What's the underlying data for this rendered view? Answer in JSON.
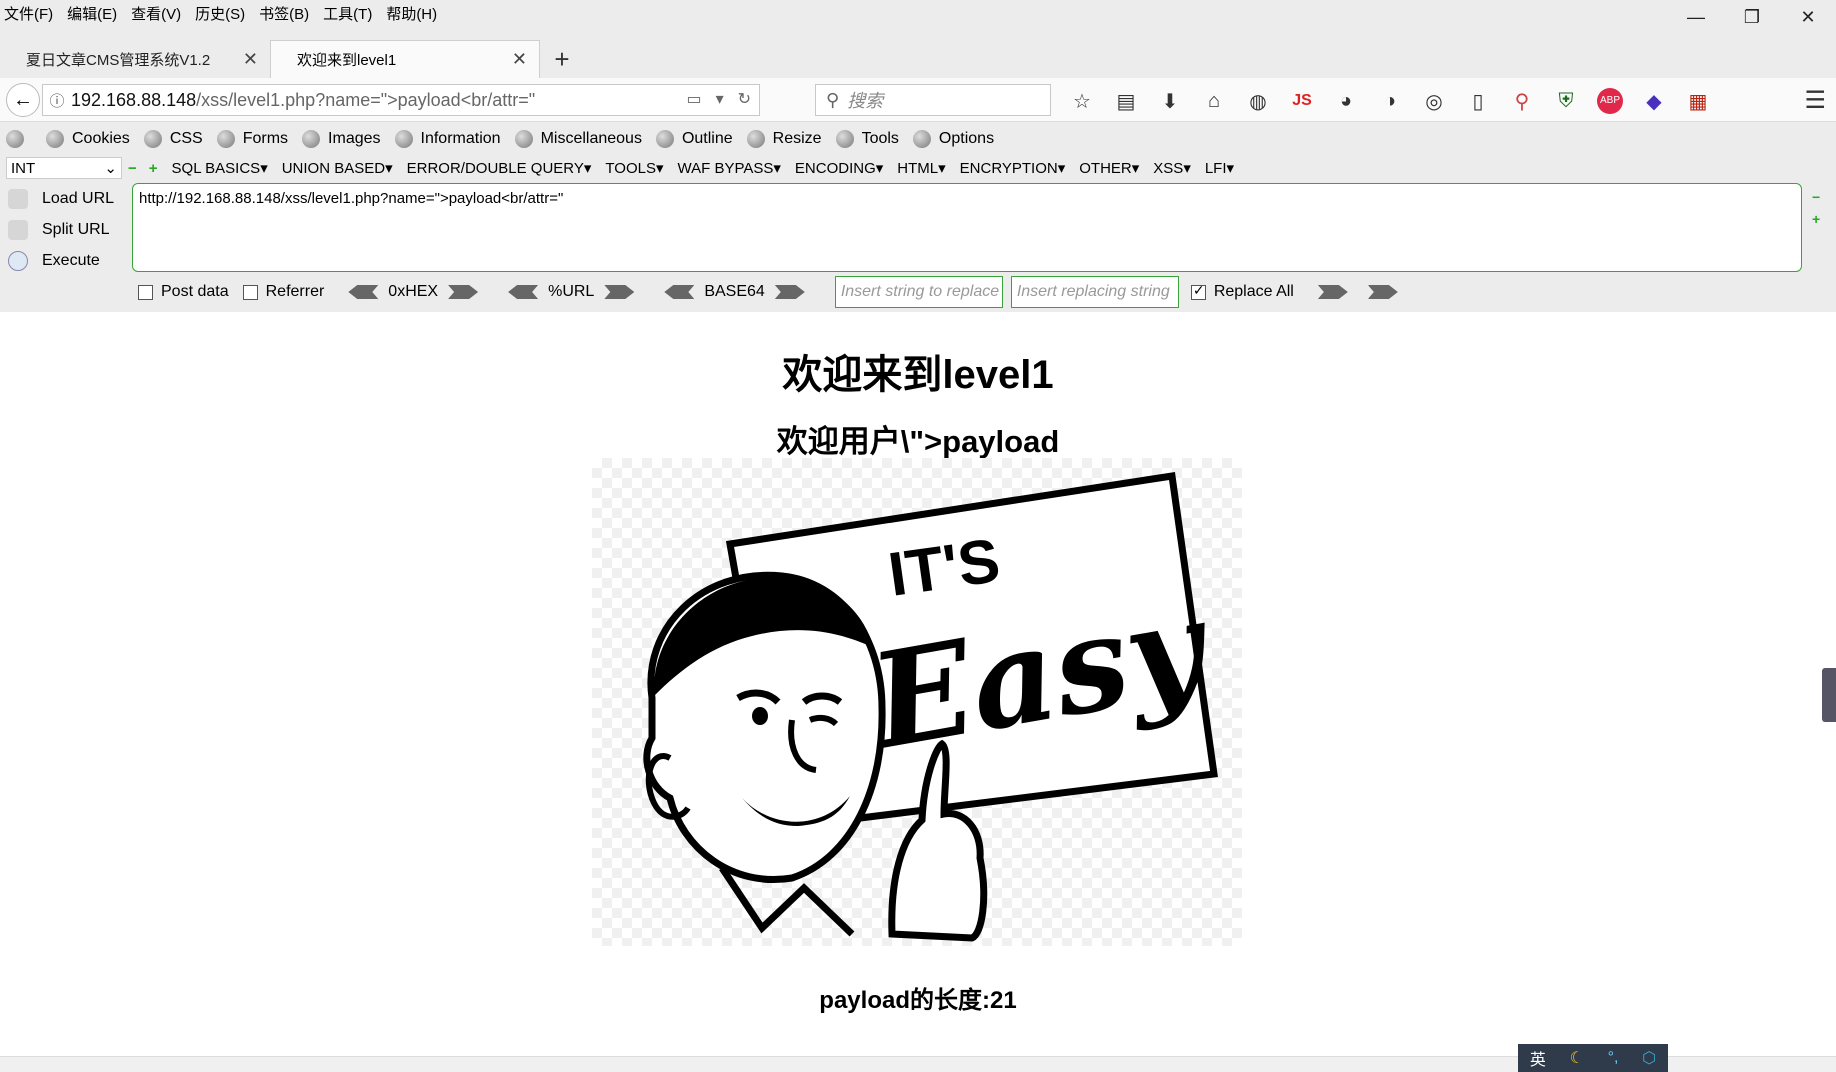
{
  "menu": [
    "文件(F)",
    "编辑(E)",
    "查看(V)",
    "历史(S)",
    "书签(B)",
    "工具(T)",
    "帮助(H)"
  ],
  "window_controls": {
    "minimize": "—",
    "restore": "❐",
    "close": "✕"
  },
  "tabs": [
    {
      "title": "夏日文章CMS管理系统V1.2",
      "close": "✕"
    },
    {
      "title": "欢迎来到level1",
      "close": "✕"
    }
  ],
  "new_tab": "+",
  "nav": {
    "back": "←",
    "url_host": "192.168.88.148",
    "url_path": "/xss/level1.php?name=\">payload<br/attr=\"",
    "reload": "↻",
    "search_placeholder": "搜索",
    "search_icon": "⚲",
    "icons": [
      "star-icon",
      "reader-icon",
      "download-icon",
      "home-icon",
      "globe-icon",
      "js-icon",
      "network-icon",
      "palette-icon",
      "vpn-icon",
      "device-icon",
      "search-ext-icon",
      "shield-icon",
      "abp-icon",
      "gem-icon",
      "grid-icon"
    ],
    "icon_glyphs": [
      "☆",
      "▤",
      "⬇",
      "⌂",
      "◍",
      "JS",
      "◕",
      "◑",
      "◎",
      "▯",
      "⚲",
      "⛨",
      "ABP",
      "◆",
      "▦"
    ],
    "menu": "☰"
  },
  "devbar": [
    "Cookies",
    "CSS",
    "Forms",
    "Images",
    "Information",
    "Miscellaneous",
    "Outline",
    "Resize",
    "Tools",
    "Options"
  ],
  "hackbar": {
    "type_select": "INT",
    "menus": [
      "SQL BASICS",
      "UNION BASED",
      "ERROR/DOUBLE QUERY",
      "TOOLS",
      "WAF BYPASS",
      "ENCODING",
      "HTML",
      "ENCRYPTION",
      "OTHER",
      "XSS",
      "LFI"
    ],
    "side": [
      "Load URL",
      "Split URL",
      "Execute"
    ],
    "url_text": "http://192.168.88.148/xss/level1.php?name=\">payload<br/attr=\"",
    "post_data": "Post data",
    "referrer": "Referrer",
    "hex": "0xHEX",
    "url_enc": "%URL",
    "base64": "BASE64",
    "find_placeholder": "Insert string to replace",
    "replace_placeholder": "Insert replacing string",
    "replace_all": "Replace All"
  },
  "page": {
    "title": "欢迎来到level1",
    "welcome": "欢迎用户\\\">payload",
    "sign_text_1": "IT'S",
    "sign_text_2": "Easy",
    "length_text": "payload的长度:21"
  },
  "ime": {
    "lang": "英",
    "items": [
      "☾",
      "°,",
      "⬡"
    ]
  }
}
